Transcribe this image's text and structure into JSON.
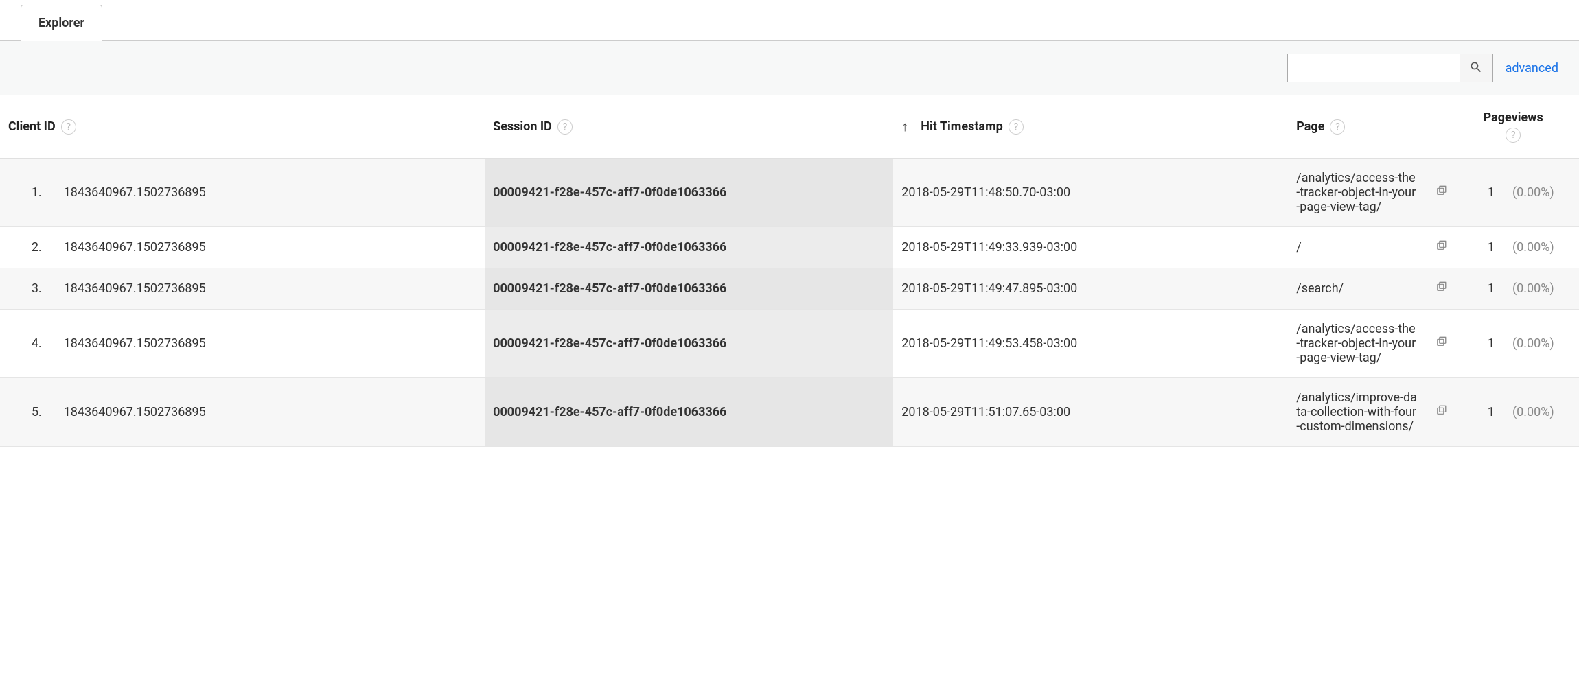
{
  "tabs": {
    "active": "Explorer"
  },
  "toolbar": {
    "advanced": "advanced",
    "search_value": ""
  },
  "columns": {
    "client_id": "Client ID",
    "session_id": "Session ID",
    "hit_timestamp": "Hit Timestamp",
    "page": "Page",
    "pageviews": "Pageviews"
  },
  "rows": [
    {
      "idx": "1.",
      "client_id": "1843640967.1502736895",
      "session_id": "00009421-f28e-457c-aff7-0f0de1063366",
      "hit_timestamp": "2018-05-29T11:48:50.70-03:00",
      "page": "/analytics/access-the-tracker-object-in-your-page-view-tag/",
      "pageviews": "1",
      "pct": "(0.00%)"
    },
    {
      "idx": "2.",
      "client_id": "1843640967.1502736895",
      "session_id": "00009421-f28e-457c-aff7-0f0de1063366",
      "hit_timestamp": "2018-05-29T11:49:33.939-03:00",
      "page": "/",
      "pageviews": "1",
      "pct": "(0.00%)"
    },
    {
      "idx": "3.",
      "client_id": "1843640967.1502736895",
      "session_id": "00009421-f28e-457c-aff7-0f0de1063366",
      "hit_timestamp": "2018-05-29T11:49:47.895-03:00",
      "page": "/search/",
      "pageviews": "1",
      "pct": "(0.00%)"
    },
    {
      "idx": "4.",
      "client_id": "1843640967.1502736895",
      "session_id": "00009421-f28e-457c-aff7-0f0de1063366",
      "hit_timestamp": "2018-05-29T11:49:53.458-03:00",
      "page": "/analytics/access-the-tracker-object-in-your-page-view-tag/",
      "pageviews": "1",
      "pct": "(0.00%)"
    },
    {
      "idx": "5.",
      "client_id": "1843640967.1502736895",
      "session_id": "00009421-f28e-457c-aff7-0f0de1063366",
      "hit_timestamp": "2018-05-29T11:51:07.65-03:00",
      "page": "/analytics/improve-data-collection-with-four-custom-dimensions/",
      "pageviews": "1",
      "pct": "(0.00%)"
    }
  ]
}
